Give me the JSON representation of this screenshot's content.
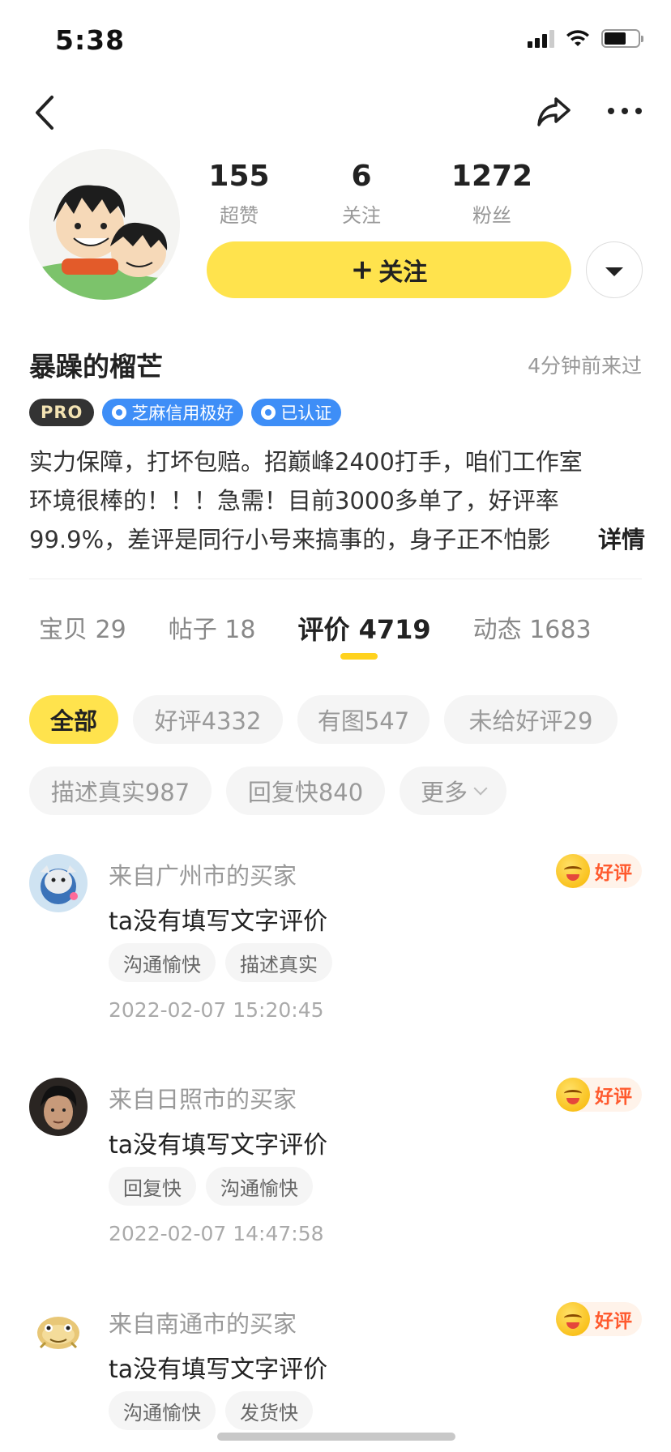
{
  "status_bar": {
    "time": "5:38"
  },
  "profile": {
    "stats": [
      {
        "value": "155",
        "label": "超赞"
      },
      {
        "value": "6",
        "label": "关注"
      },
      {
        "value": "1272",
        "label": "粉丝"
      }
    ],
    "follow_label": "关注",
    "name": "暴躁的榴芒",
    "last_seen": "4分钟前来过",
    "badges": {
      "pro": "PRO",
      "credit": "芝麻信用极好",
      "verified": "已认证"
    },
    "bio": "实力保障，打坏包赔。招巅峰2400打手，咱们工作室环境很棒的！！！急需！目前3000多单了，好评率99.9%，差评是同行小号来搞事的，身子正不怕影",
    "bio_more": "详情"
  },
  "tabs": [
    {
      "label": "宝贝 29"
    },
    {
      "label": "帖子 18"
    },
    {
      "label": "评价 4719"
    },
    {
      "label": "动态 1683"
    }
  ],
  "filters": [
    "全部",
    "好评4332",
    "有图547",
    "未给好评29",
    "描述真实987",
    "回复快840",
    "更多"
  ],
  "reviews": [
    {
      "from": "来自广州市的买家",
      "text": "ta没有填写文字评价",
      "tags": [
        "沟通愉快",
        "描述真实"
      ],
      "date": "2022-02-07 15:20:45",
      "rating": "好评"
    },
    {
      "from": "来自日照市的买家",
      "text": "ta没有填写文字评价",
      "tags": [
        "回复快",
        "沟通愉快"
      ],
      "date": "2022-02-07 14:47:58",
      "rating": "好评"
    },
    {
      "from": "来自南通市的买家",
      "text": "ta没有填写文字评价",
      "tags": [
        "沟通愉快",
        "发货快"
      ],
      "date": "",
      "rating": "好评"
    }
  ],
  "colors": {
    "accent_yellow": "#ffe34d",
    "badge_blue": "#3e8ef7",
    "rating_orange": "#ff5a2e"
  }
}
